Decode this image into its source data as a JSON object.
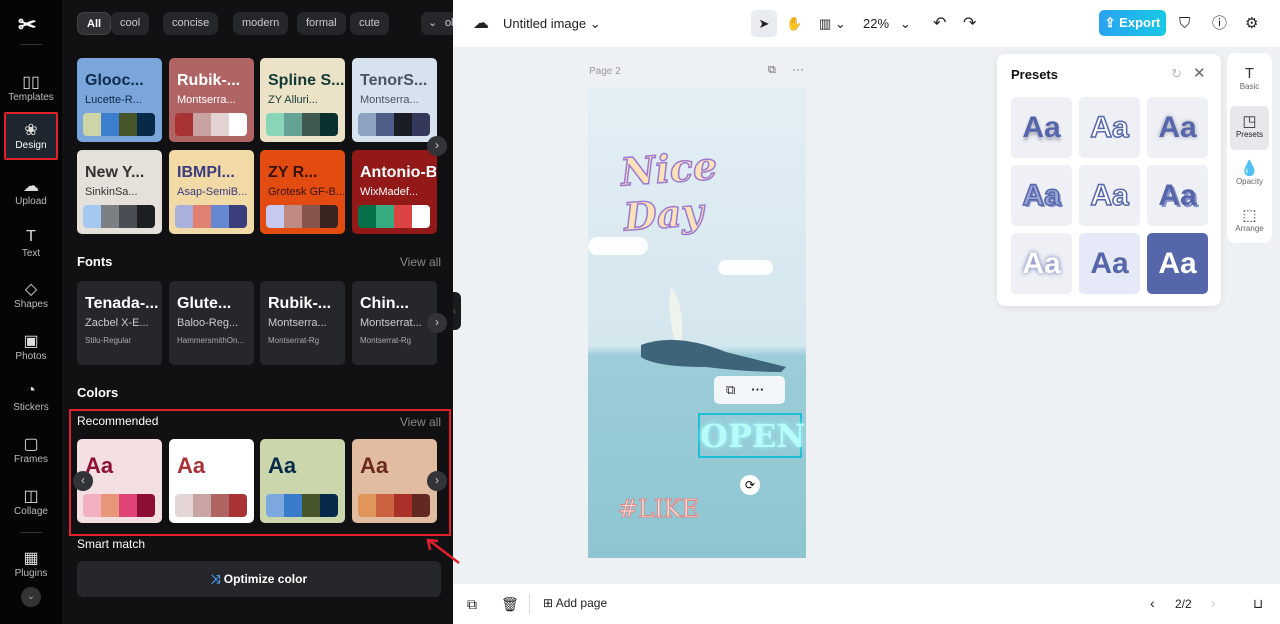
{
  "rail": {
    "items": [
      {
        "label": "Templates",
        "icon": "templates-icon"
      },
      {
        "label": "Design",
        "icon": "design-icon"
      },
      {
        "label": "Upload",
        "icon": "upload-icon"
      },
      {
        "label": "Text",
        "icon": "text-icon"
      },
      {
        "label": "Shapes",
        "icon": "shapes-icon"
      },
      {
        "label": "Photos",
        "icon": "photos-icon"
      },
      {
        "label": "Stickers",
        "icon": "stickers-icon"
      },
      {
        "label": "Frames",
        "icon": "frames-icon"
      },
      {
        "label": "Collage",
        "icon": "collage-icon"
      },
      {
        "label": "Plugins",
        "icon": "plugins-icon"
      }
    ],
    "active": "Design"
  },
  "panel": {
    "chips": [
      "All",
      "cool",
      "concise",
      "modern",
      "formal",
      "cute",
      "Holiday"
    ],
    "themes": [
      {
        "t1": "Glooc...",
        "t2": "Lucette-R...",
        "bg": "#7ba6dc",
        "fg": "#0e2b4a",
        "colors": [
          "#cdd4a6",
          "#3c7fcf",
          "#46562a",
          "#07294a"
        ]
      },
      {
        "t1": "Rubik-...",
        "t2": "Montserra...",
        "bg": "#b06464",
        "fg": "#ffffff",
        "colors": [
          "#a83234",
          "#c9a2a2",
          "#e3d3d3",
          "#ffffff"
        ]
      },
      {
        "t1": "Spline S...",
        "t2": "ZY Alluri...",
        "bg": "#ece2c8",
        "fg": "#123a34",
        "colors": [
          "#88d6b8",
          "#64a394",
          "#3f5850",
          "#0a302f"
        ]
      },
      {
        "t1": "TenorS...",
        "t2": "Montserra...",
        "bg": "#d6e2ee",
        "fg": "#4a5264",
        "colors": [
          "#8ea2c2",
          "#505e8a",
          "#1a1c26",
          "#34385a"
        ]
      },
      {
        "t1": "New Y...",
        "t2": "SinkinSa...",
        "bg": "#e6e0da",
        "fg": "#333",
        "colors": [
          "#a4c8f0",
          "#7c8084",
          "#4a4e54",
          "#1c1e22"
        ]
      },
      {
        "t1": "IBMPl...",
        "t2": "Asap-SemiB...",
        "bg": "#f2daa6",
        "fg": "#3a3c80",
        "colors": [
          "#aab0dc",
          "#e08070",
          "#6688d0",
          "#3a3e7c"
        ]
      },
      {
        "t1": "ZY R...",
        "t2": "Grotesk GF-B...",
        "bg": "#e24c10",
        "fg": "#3a1208",
        "colors": [
          "#c6caf0",
          "#c08a84",
          "#86544c",
          "#3a2420"
        ]
      },
      {
        "t1": "Antonio-Bold",
        "t2": "WixMadef...",
        "bg": "#931818",
        "fg": "#ffffff",
        "colors": [
          "#067048",
          "#36ac80",
          "#dc4444",
          "#ffffff"
        ]
      }
    ],
    "fonts_title": "Fonts",
    "view_all": "View all",
    "fonts": [
      {
        "t1": "Tenada-...",
        "t2": "Zacbel X-E...",
        "t3": "Stilu-Regular"
      },
      {
        "t1": "Glute...",
        "t2": "Baloo-Reg...",
        "t3": "HammersmithOn..."
      },
      {
        "t1": "Rubik-...",
        "t2": "Montserra...",
        "t3": "Montserrat-Rg"
      },
      {
        "t1": "Chin...",
        "t2": "Montserrat...",
        "t3": "Montserrat-Rg"
      }
    ],
    "colors_title": "Colors",
    "recommended": "Recommended",
    "palettes": [
      {
        "aa": "Aa",
        "bg": "#f4dfe2",
        "fg": "#8e1234",
        "colors": [
          "#f2b0c0",
          "#e8967a",
          "#e04476",
          "#8c0e34"
        ]
      },
      {
        "aa": "Aa",
        "bg": "#ffffff",
        "fg": "#a83234",
        "colors": [
          "#e4d6d6",
          "#c8a4a4",
          "#b06464",
          "#a83234"
        ]
      },
      {
        "aa": "Aa",
        "bg": "#ccd6ac",
        "fg": "#072a48",
        "colors": [
          "#7ca8e0",
          "#3a7ccc",
          "#46562a",
          "#07294a"
        ]
      },
      {
        "aa": "Aa",
        "bg": "#e2bca0",
        "fg": "#6a2a20",
        "colors": [
          "#e09658",
          "#cc6240",
          "#aa3228",
          "#622822"
        ]
      }
    ],
    "smart_match": "Smart match",
    "optimize": "Optimize color"
  },
  "toolbar": {
    "title": "Untitled image",
    "zoom": "22%",
    "export": "Export"
  },
  "canvas": {
    "page_label": "Page 2",
    "texts": {
      "nice_day": "Nice Day",
      "open": "OPEN",
      "like": "#LIKE"
    }
  },
  "presets": {
    "title": "Presets",
    "items": [
      "Aa",
      "Aa",
      "Aa",
      "Aa",
      "Aa",
      "Aa",
      "Aa",
      "Aa",
      "Aa"
    ]
  },
  "side": {
    "items": [
      "Basic",
      "Presets",
      "Opacity",
      "Arrange"
    ],
    "active": "Presets"
  },
  "bottom": {
    "add_page": "Add page",
    "page_count": "2/2"
  }
}
